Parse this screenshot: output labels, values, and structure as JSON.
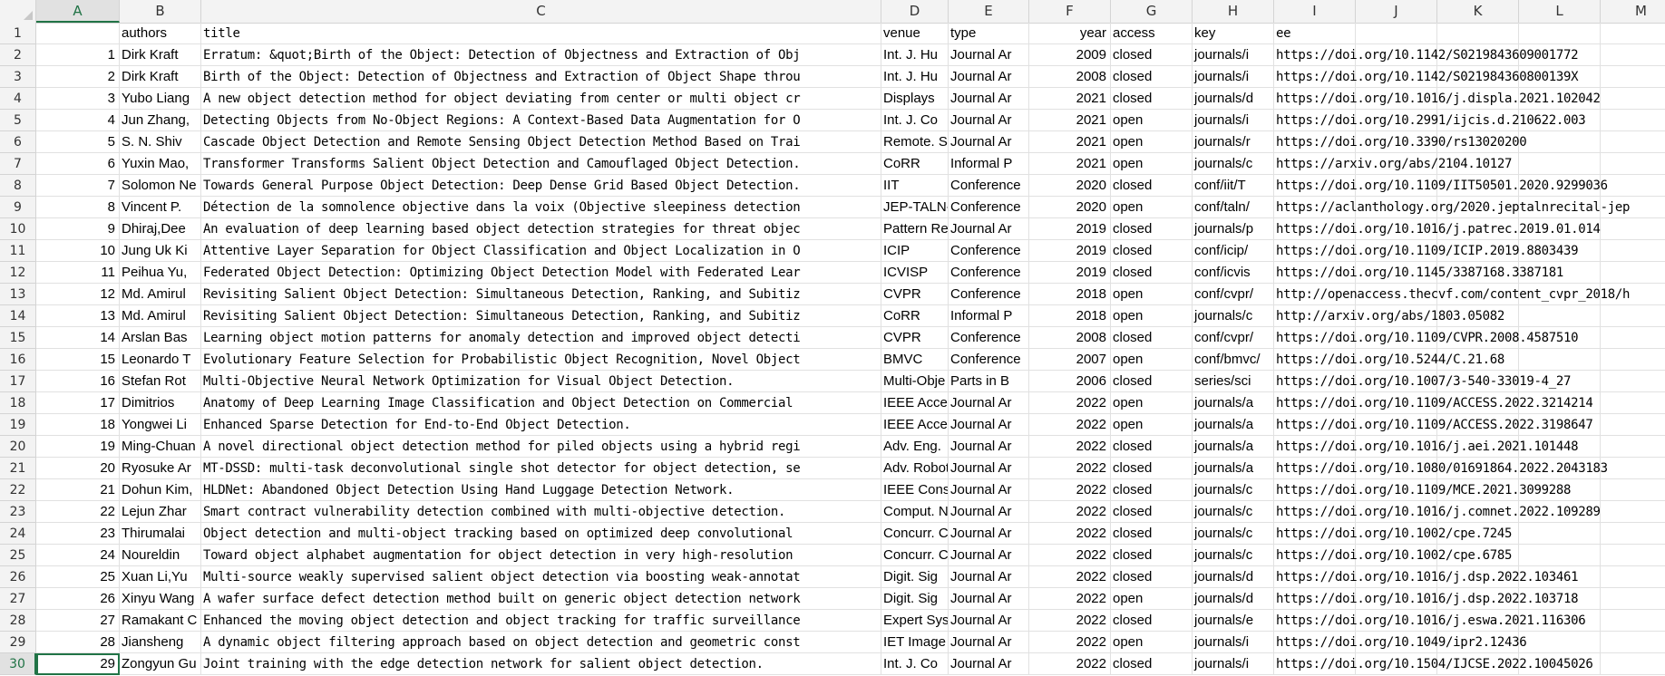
{
  "columns": [
    "A",
    "B",
    "C",
    "D",
    "E",
    "F",
    "G",
    "H",
    "I",
    "J",
    "K",
    "L",
    "M"
  ],
  "selected_column": "A",
  "selected_row": 30,
  "header_row": {
    "row": 1,
    "A": "",
    "authors": "authors",
    "title": "title",
    "venue": "venue",
    "type": "type",
    "year": "year",
    "access": "access",
    "key": "key",
    "ee": "ee"
  },
  "rows": [
    {
      "row": 2,
      "A": "1",
      "authors": "Dirk Kraft",
      "title": "Erratum: &quot;Birth of the Object: Detection of Objectness and Extraction of Obj",
      "venue": "Int. J. Hu",
      "type": "Journal Ar",
      "year": "2009",
      "access": "closed",
      "key": "journals/i",
      "ee": "https://doi.org/10.1142/S0219843609001772"
    },
    {
      "row": 3,
      "A": "2",
      "authors": "Dirk Kraft",
      "title": "Birth of the Object: Detection of Objectness and Extraction of Object Shape throu",
      "venue": "Int. J. Hu",
      "type": "Journal Ar",
      "year": "2008",
      "access": "closed",
      "key": "journals/i",
      "ee": "https://doi.org/10.1142/S021984360800139X"
    },
    {
      "row": 4,
      "A": "3",
      "authors": "Yubo Liang",
      "title": "A new object detection method for object deviating from center or multi object cr",
      "venue": "Displays",
      "type": "Journal Ar",
      "year": "2021",
      "access": "closed",
      "key": "journals/d",
      "ee": "https://doi.org/10.1016/j.displa.2021.102042"
    },
    {
      "row": 5,
      "A": "4",
      "authors": "Jun Zhang,",
      "title": "Detecting Objects from No-Object Regions: A Context-Based Data Augmentation for O",
      "venue": "Int. J. Co",
      "type": "Journal Ar",
      "year": "2021",
      "access": "open",
      "key": "journals/i",
      "ee": "https://doi.org/10.2991/ijcis.d.210622.003"
    },
    {
      "row": 6,
      "A": "5",
      "authors": "S. N. Shiv",
      "title": "Cascade Object Detection and Remote Sensing Object Detection Method Based on Trai",
      "venue": "Remote. Se",
      "type": "Journal Ar",
      "year": "2021",
      "access": "open",
      "key": "journals/r",
      "ee": "https://doi.org/10.3390/rs13020200"
    },
    {
      "row": 7,
      "A": "6",
      "authors": "Yuxin Mao,",
      "title": "Transformer Transforms Salient Object Detection and Camouflaged Object Detection.",
      "venue": "CoRR",
      "type": "Informal P",
      "year": "2021",
      "access": "open",
      "key": "journals/c",
      "ee": "https://arxiv.org/abs/2104.10127"
    },
    {
      "row": 8,
      "A": "7",
      "authors": "Solomon Ne",
      "title": "Towards General Purpose Object Detection: Deep Dense Grid Based Object Detection.",
      "venue": "IIT",
      "type": "Conference",
      "year": "2020",
      "access": "closed",
      "key": "conf/iit/T",
      "ee": "https://doi.org/10.1109/IIT50501.2020.9299036"
    },
    {
      "row": 9,
      "A": "8",
      "authors": "Vincent P.",
      "title": "Détection de la somnolence objective dans la voix (Objective sleepiness detection",
      "venue": "JEP-TALN-R",
      "type": "Conference",
      "year": "2020",
      "access": "open",
      "key": "conf/taln/",
      "ee": "https://aclanthology.org/2020.jeptalnrecital-jep"
    },
    {
      "row": 10,
      "A": "9",
      "authors": "Dhiraj,Dee",
      "title": "An evaluation of deep learning based object detection strategies for threat objec",
      "venue": "Pattern Re",
      "type": "Journal Ar",
      "year": "2019",
      "access": "closed",
      "key": "journals/p",
      "ee": "https://doi.org/10.1016/j.patrec.2019.01.014"
    },
    {
      "row": 11,
      "A": "10",
      "authors": "Jung Uk Ki",
      "title": "Attentive Layer Separation for Object Classification and Object Localization in O",
      "venue": "ICIP",
      "type": "Conference",
      "year": "2019",
      "access": "closed",
      "key": "conf/icip/",
      "ee": "https://doi.org/10.1109/ICIP.2019.8803439"
    },
    {
      "row": 12,
      "A": "11",
      "authors": "Peihua Yu,",
      "title": "Federated Object Detection: Optimizing Object Detection Model with Federated Lear",
      "venue": "ICVISP",
      "type": "Conference",
      "year": "2019",
      "access": "closed",
      "key": "conf/icvis",
      "ee": "https://doi.org/10.1145/3387168.3387181"
    },
    {
      "row": 13,
      "A": "12",
      "authors": "Md. Amirul",
      "title": "Revisiting Salient Object Detection: Simultaneous Detection, Ranking, and Subitiz",
      "venue": "CVPR",
      "type": "Conference",
      "year": "2018",
      "access": "open",
      "key": "conf/cvpr/",
      "ee": "http://openaccess.thecvf.com/content_cvpr_2018/h"
    },
    {
      "row": 14,
      "A": "13",
      "authors": "Md. Amirul",
      "title": "Revisiting Salient Object Detection: Simultaneous Detection, Ranking, and Subitiz",
      "venue": "CoRR",
      "type": "Informal P",
      "year": "2018",
      "access": "open",
      "key": "journals/c",
      "ee": "http://arxiv.org/abs/1803.05082"
    },
    {
      "row": 15,
      "A": "14",
      "authors": "Arslan Bas",
      "title": "Learning object motion patterns for anomaly detection and improved object detecti",
      "venue": "CVPR",
      "type": "Conference",
      "year": "2008",
      "access": "closed",
      "key": "conf/cvpr/",
      "ee": "https://doi.org/10.1109/CVPR.2008.4587510"
    },
    {
      "row": 16,
      "A": "15",
      "authors": "Leonardo T",
      "title": "Evolutionary Feature Selection for Probabilistic Object Recognition, Novel Object",
      "venue": "BMVC",
      "type": "Conference",
      "year": "2007",
      "access": "open",
      "key": "conf/bmvc/",
      "ee": "https://doi.org/10.5244/C.21.68"
    },
    {
      "row": 17,
      "A": "16",
      "authors": "Stefan Rot",
      "title": "Multi-Objective Neural Network Optimization for Visual Object Detection.",
      "venue": "Multi-Obje",
      "type": "Parts in B",
      "year": "2006",
      "access": "closed",
      "key": "series/sci",
      "ee": "https://doi.org/10.1007/3-540-33019-4_27"
    },
    {
      "row": 18,
      "A": "17",
      "authors": "Dimitrios",
      "title": "Anatomy of Deep Learning Image Classification and Object Detection on Commercial",
      "venue": "IEEE Acces",
      "type": "Journal Ar",
      "year": "2022",
      "access": "open",
      "key": "journals/a",
      "ee": "https://doi.org/10.1109/ACCESS.2022.3214214"
    },
    {
      "row": 19,
      "A": "18",
      "authors": "Yongwei Li",
      "title": "Enhanced Sparse Detection for End-to-End Object Detection.",
      "venue": "IEEE Acces",
      "type": "Journal Ar",
      "year": "2022",
      "access": "open",
      "key": "journals/a",
      "ee": "https://doi.org/10.1109/ACCESS.2022.3198647"
    },
    {
      "row": 20,
      "A": "19",
      "authors": "Ming-Chuan",
      "title": "A novel directional object detection method for piled objects using a hybrid regi",
      "venue": "Adv. Eng.",
      "type": "Journal Ar",
      "year": "2022",
      "access": "closed",
      "key": "journals/a",
      "ee": "https://doi.org/10.1016/j.aei.2021.101448"
    },
    {
      "row": 21,
      "A": "20",
      "authors": "Ryosuke Ar",
      "title": "MT-DSSD: multi-task deconvolutional single shot detector for object detection, se",
      "venue": "Adv. Robot",
      "type": "Journal Ar",
      "year": "2022",
      "access": "closed",
      "key": "journals/a",
      "ee": "https://doi.org/10.1080/01691864.2022.2043183"
    },
    {
      "row": 22,
      "A": "21",
      "authors": "Dohun Kim,",
      "title": "HLDNet: Abandoned Object Detection Using Hand Luggage Detection Network.",
      "venue": "IEEE Consu",
      "type": "Journal Ar",
      "year": "2022",
      "access": "closed",
      "key": "journals/c",
      "ee": "https://doi.org/10.1109/MCE.2021.3099288"
    },
    {
      "row": 23,
      "A": "22",
      "authors": "Lejun Zhar",
      "title": "Smart contract vulnerability detection combined with multi-objective detection.",
      "venue": "Comput. Ne",
      "type": "Journal Ar",
      "year": "2022",
      "access": "closed",
      "key": "journals/c",
      "ee": "https://doi.org/10.1016/j.comnet.2022.109289"
    },
    {
      "row": 24,
      "A": "23",
      "authors": "Thirumalai",
      "title": "Object detection and multi-object tracking based on optimized deep convolutional",
      "venue": "Concurr. C",
      "type": "Journal Ar",
      "year": "2022",
      "access": "closed",
      "key": "journals/c",
      "ee": "https://doi.org/10.1002/cpe.7245"
    },
    {
      "row": 25,
      "A": "24",
      "authors": "Noureldin",
      "title": "Toward object alphabet augmentation for object detection in very high-resolution",
      "venue": "Concurr. C",
      "type": "Journal Ar",
      "year": "2022",
      "access": "closed",
      "key": "journals/c",
      "ee": "https://doi.org/10.1002/cpe.6785"
    },
    {
      "row": 26,
      "A": "25",
      "authors": "Xuan Li,Yu",
      "title": "Multi-source weakly supervised salient object detection via boosting weak-annotat",
      "venue": "Digit. Sig",
      "type": "Journal Ar",
      "year": "2022",
      "access": "closed",
      "key": "journals/d",
      "ee": "https://doi.org/10.1016/j.dsp.2022.103461"
    },
    {
      "row": 27,
      "A": "26",
      "authors": "Xinyu Wang",
      "title": "A wafer surface defect detection method built on generic object detection network",
      "venue": "Digit. Sig",
      "type": "Journal Ar",
      "year": "2022",
      "access": "open",
      "key": "journals/d",
      "ee": "https://doi.org/10.1016/j.dsp.2022.103718"
    },
    {
      "row": 28,
      "A": "27",
      "authors": "Ramakant C",
      "title": "Enhanced the moving object detection and object tracking for traffic surveillance",
      "venue": "Expert Sys",
      "type": "Journal Ar",
      "year": "2022",
      "access": "closed",
      "key": "journals/e",
      "ee": "https://doi.org/10.1016/j.eswa.2021.116306"
    },
    {
      "row": 29,
      "A": "28",
      "authors": "Jiansheng",
      "title": "A dynamic object filtering approach based on object detection and geometric const",
      "venue": "IET Image",
      "type": "Journal Ar",
      "year": "2022",
      "access": "open",
      "key": "journals/i",
      "ee": "https://doi.org/10.1049/ipr2.12436"
    },
    {
      "row": 30,
      "A": "29",
      "authors": "Zongyun Gu",
      "title": "Joint training with the edge detection network for salient object detection.",
      "venue": "Int. J. Co",
      "type": "Journal Ar",
      "year": "2022",
      "access": "closed",
      "key": "journals/i",
      "ee": "https://doi.org/10.1504/IJCSE.2022.10045026"
    }
  ]
}
